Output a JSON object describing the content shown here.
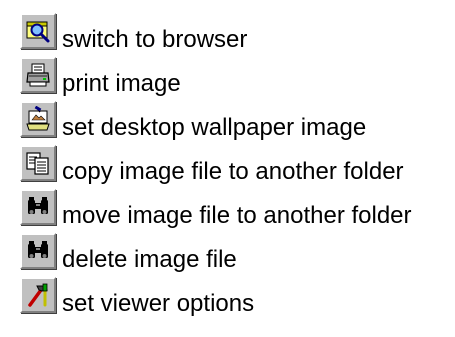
{
  "items": [
    {
      "label": "switch to browser",
      "icon": "browser-magnifier-icon"
    },
    {
      "label": "print image",
      "icon": "printer-icon"
    },
    {
      "label": "set desktop wallpaper image",
      "icon": "wallpaper-icon"
    },
    {
      "label": "copy image file to another folder",
      "icon": "copy-pages-icon"
    },
    {
      "label": "move image file to another folder",
      "icon": "binoculars-icon"
    },
    {
      "label": "delete image file",
      "icon": "binoculars-icon"
    },
    {
      "label": "set viewer options",
      "icon": "tools-icon"
    }
  ]
}
